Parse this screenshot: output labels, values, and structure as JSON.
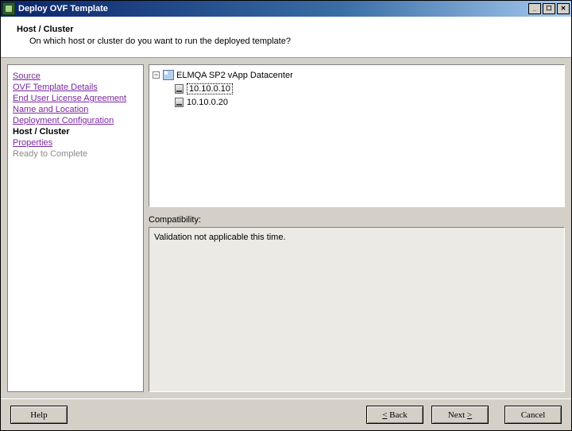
{
  "window": {
    "title": "Deploy OVF Template"
  },
  "header": {
    "title": "Host / Cluster",
    "subtitle": "On which host or cluster do you want to run the deployed template?"
  },
  "nav": {
    "items": [
      {
        "label": "Source",
        "state": "link"
      },
      {
        "label": "OVF Template Details",
        "state": "link"
      },
      {
        "label": "End User License Agreement",
        "state": "link"
      },
      {
        "label": "Name and Location",
        "state": "link"
      },
      {
        "label": "Deployment Configuration",
        "state": "link"
      },
      {
        "label": "Host / Cluster",
        "state": "current"
      },
      {
        "label": "Properties",
        "state": "link"
      },
      {
        "label": "Ready to Complete",
        "state": "disabled"
      }
    ]
  },
  "tree": {
    "root_label": "ELMQA SP2 vApp Datacenter",
    "hosts": [
      {
        "label": "10.10.0.10",
        "selected": true
      },
      {
        "label": "10.10.0.20",
        "selected": false
      }
    ]
  },
  "compat": {
    "label": "Compatibility:",
    "message": "Validation not applicable this time."
  },
  "buttons": {
    "help": "Help",
    "back_pre": "<",
    "back": " Back",
    "next": "Next ",
    "next_post": ">",
    "cancel": "Cancel"
  }
}
